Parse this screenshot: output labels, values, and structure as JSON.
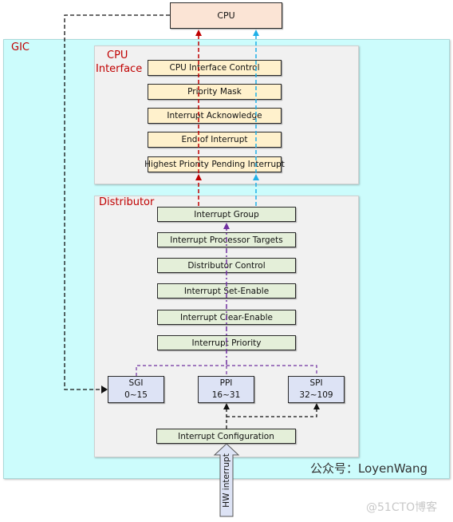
{
  "cpu": {
    "label": "CPU"
  },
  "gic": {
    "label": "GIC"
  },
  "cpu_interface": {
    "title_line1": "CPU",
    "title_line2": "Interface",
    "registers": [
      "CPU Interface Control",
      "Priority Mask",
      "Interrupt Acknowledge",
      "End of Interrupt",
      "Highest Priority Pending Interrupt"
    ]
  },
  "distributor": {
    "title": "Distributor",
    "registers": [
      "Interrupt Group",
      "Interrupt Processor Targets",
      "Distributor Control",
      "Interrupt Set-Enable",
      "Interrupt Clear-Enable",
      "Interrupt Priority"
    ],
    "interrupt_types": [
      {
        "name": "SGI",
        "range": "0~15"
      },
      {
        "name": "PPI",
        "range": "16~31"
      },
      {
        "name": "SPI",
        "range": "32~109"
      }
    ],
    "configuration": "Interrupt Configuration"
  },
  "hw_interrupt": {
    "label": "HW interrupt"
  },
  "watermarks": {
    "author": "公众号：LoyenWang",
    "site": "@51CTO博客"
  },
  "colors": {
    "gic_bg": "#ccfcfc",
    "panel_bg": "#f1f1f1",
    "cpu_bg": "#fbe4d5",
    "cpu_interface_box": "#fff1cc",
    "distributor_box": "#e4efd9",
    "interrupt_type_box": "#dde3f5",
    "title_red": "#c00000",
    "arrow_red": "#c00000",
    "arrow_blue": "#1fb0e8",
    "arrow_purple": "#7030a0",
    "arrow_black": "#111111"
  }
}
